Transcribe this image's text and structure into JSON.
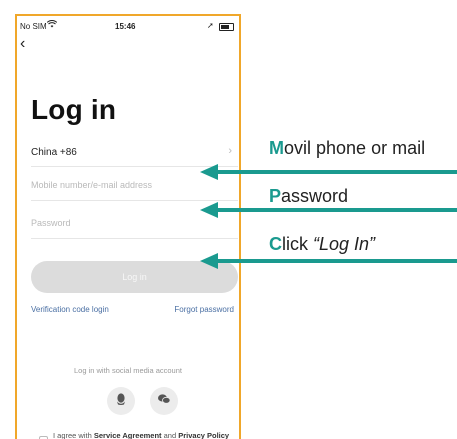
{
  "status_bar": {
    "carrier": "No SIM",
    "time": "15:46"
  },
  "screen": {
    "title": "Log in",
    "country_code": "China +86",
    "email_placeholder": "Mobile number/e-mail address",
    "password_placeholder": "Password",
    "login_button": "Log in",
    "verification_link": "Verification code login",
    "forgot_link": "Forgot password",
    "social_label": "Log in with social media account",
    "agreement": {
      "prefix": "I agree with ",
      "service": "Service Agreement",
      "and": " and ",
      "privacy": "Privacy Policy"
    }
  },
  "annotations": [
    {
      "initial": "M",
      "rest": "ovil phone or mail"
    },
    {
      "initial": "P",
      "rest": "assword"
    },
    {
      "initial": "C",
      "rest": "lick ",
      "quote": "“Log In”"
    }
  ],
  "colors": {
    "accent": "#1a9a8f",
    "phone_border": "#f0a72a",
    "link": "#4a6fa3"
  },
  "icons": [
    "back-chevron-icon",
    "wifi-icon",
    "battery-icon",
    "location-icon",
    "chevron-right-icon",
    "qq-icon",
    "wechat-icon",
    "checkbox-icon"
  ]
}
